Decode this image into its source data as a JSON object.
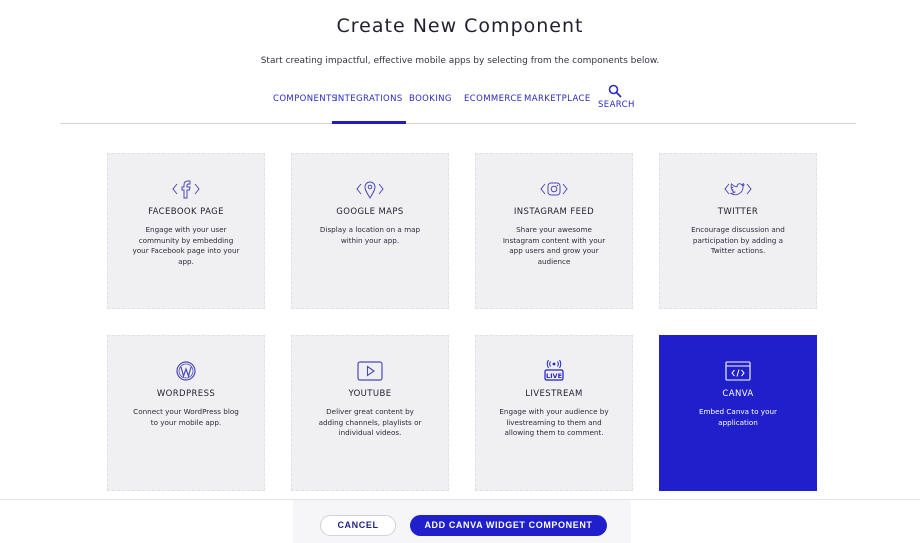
{
  "header": {
    "title": "Create New Component",
    "subtitle": "Start creating impactful, effective mobile apps by selecting from the components below."
  },
  "tabs": [
    {
      "label": "COMPONENTS",
      "active": false
    },
    {
      "label": "INTEGRATIONS",
      "active": true
    },
    {
      "label": "BOOKING",
      "active": false
    },
    {
      "label": "ECOMMERCE",
      "active": false
    },
    {
      "label": "MARKETPLACE",
      "active": false
    }
  ],
  "search_tab": {
    "label": "SEARCH",
    "icon": "search-icon"
  },
  "cards": [
    {
      "name": "FACEBOOK PAGE",
      "icon": "facebook-icon",
      "desc": "Engage with your user community by embedding your Facebook page into your app.",
      "selected": false
    },
    {
      "name": "GOOGLE MAPS",
      "icon": "map-pin-icon",
      "desc": "Display a location on a map within your app.",
      "selected": false
    },
    {
      "name": "INSTAGRAM FEED",
      "icon": "instagram-icon",
      "desc": "Share your awesome Instagram content with your app users and grow your audience",
      "selected": false
    },
    {
      "name": "TWITTER",
      "icon": "twitter-icon",
      "desc": "Encourage discussion and participation by adding a Twitter actions.",
      "selected": false
    },
    {
      "name": "WORDPRESS",
      "icon": "wordpress-icon",
      "desc": "Connect your WordPress blog to your mobile app.",
      "selected": false
    },
    {
      "name": "YOUTUBE",
      "icon": "youtube-icon",
      "desc": "Deliver great content by adding channels, playlists or individual videos.",
      "selected": false
    },
    {
      "name": "LIVESTREAM",
      "icon": "livestream-icon",
      "desc": "Engage with your audience by livestreaming to them and allowing them to comment.",
      "selected": false
    },
    {
      "name": "CANVA",
      "icon": "code-window-icon",
      "desc": "Embed Canva to your application",
      "selected": true
    }
  ],
  "footer": {
    "cancel_label": "CANCEL",
    "add_label": "ADD CANVA WIDGET COMPONENT"
  },
  "colors": {
    "accent": "#1f1fcc",
    "card_bg": "#f0f0f3",
    "tab_text": "#2a2abf"
  }
}
